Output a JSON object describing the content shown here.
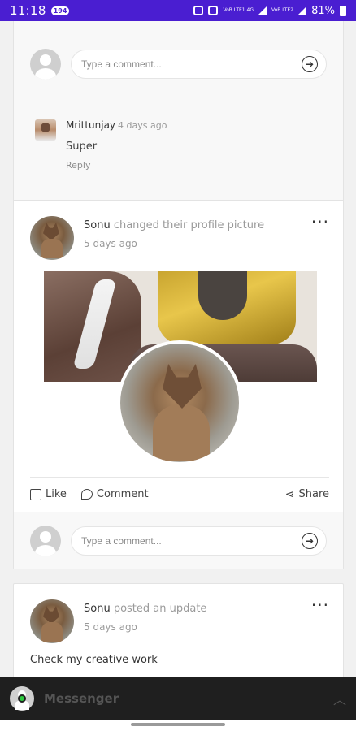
{
  "status_bar": {
    "time": "11:18",
    "notif_badge": "194",
    "battery": "81%",
    "net1": "VoB LTE1 4G",
    "net2": "VoB LTE2"
  },
  "comment_box": {
    "placeholder": "Type a comment..."
  },
  "reply": {
    "author": "Mrittunjay",
    "ago": "4 days ago",
    "text": "Super",
    "reply_label": "Reply"
  },
  "post1": {
    "author": "Sonu",
    "action": "changed their profile picture",
    "ago": "5 days ago",
    "like_label": "Like",
    "comment_label": "Comment",
    "share_label": "Share"
  },
  "post2": {
    "author": "Sonu",
    "action": "posted an update",
    "ago": "5 days ago",
    "text": "Check my creative work"
  },
  "messenger": {
    "label": "Messenger"
  }
}
